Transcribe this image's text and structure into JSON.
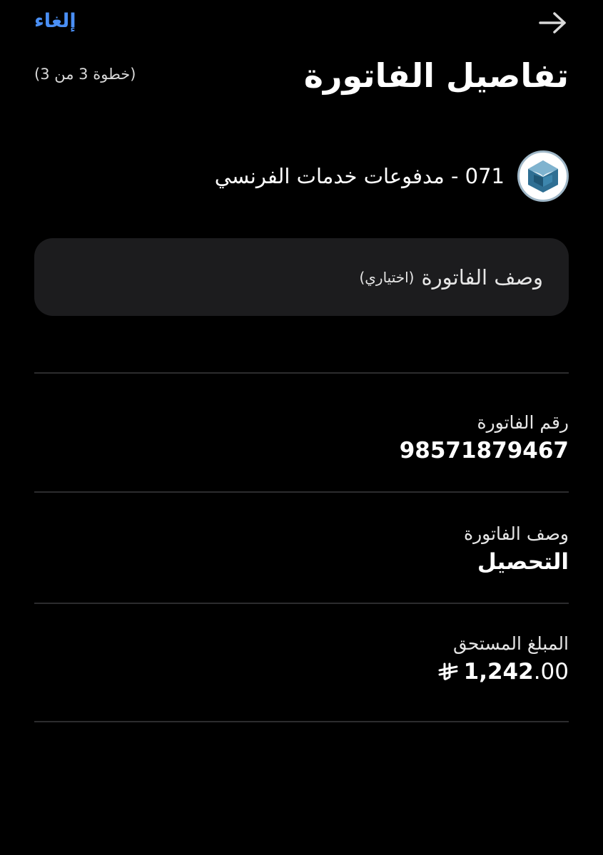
{
  "header": {
    "cancel_label": "إلغاء",
    "back_icon": "arrow-right-icon",
    "title": "تفاصيل الفاتورة",
    "step": "(خطوة 3 من 3)"
  },
  "biller": {
    "logo_icon": "bank-logo-icon",
    "name": "071 - مدفوعات خدمات الفرنسي"
  },
  "description_input": {
    "placeholder_main": "وصف الفاتورة",
    "placeholder_optional": "(اختياري)",
    "value": ""
  },
  "fields": {
    "invoice_number": {
      "label": "رقم الفاتورة",
      "value": "98571879467"
    },
    "invoice_description": {
      "label": "وصف الفاتورة",
      "value": "التحصيل"
    },
    "amount_due": {
      "label": "المبلغ المستحق",
      "whole": "1,242",
      "decimals": ".00",
      "currency_icon": "saudi-riyal-icon"
    }
  },
  "colors": {
    "background": "#000000",
    "accent_link": "#4a8ff5",
    "input_background": "#1c1c1e",
    "divider": "#2c2c2e"
  }
}
